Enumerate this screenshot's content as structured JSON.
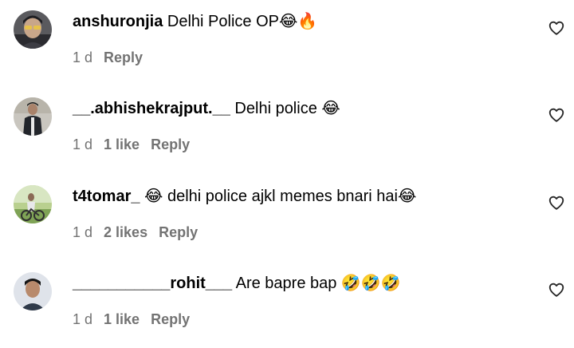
{
  "comments": [
    {
      "avatar_icon": "avatar-icon",
      "username": "anshuronjia",
      "text": " Delhi Police OP😂🔥",
      "time": "1 d",
      "likes": "",
      "reply": "Reply",
      "like_icon": "heart-outline-icon"
    },
    {
      "avatar_icon": "avatar-icon",
      "username": "__.abhishekrajput.__",
      "text": " Delhi police 😂",
      "time": "1 d",
      "likes": "1 like",
      "reply": "Reply",
      "like_icon": "heart-outline-icon"
    },
    {
      "avatar_icon": "avatar-icon",
      "username": "t4tomar_",
      "text": " 😂 delhi police ajkl memes bnari hai😂",
      "time": "1 d",
      "likes": "2 likes",
      "reply": "Reply",
      "like_icon": "heart-outline-icon"
    },
    {
      "avatar_icon": "avatar-icon",
      "username": "___________rohit___",
      "text": " Are bapre bap 🤣🤣🤣",
      "time": "1 d",
      "likes": "1 like",
      "reply": "Reply",
      "like_icon": "heart-outline-icon"
    }
  ]
}
